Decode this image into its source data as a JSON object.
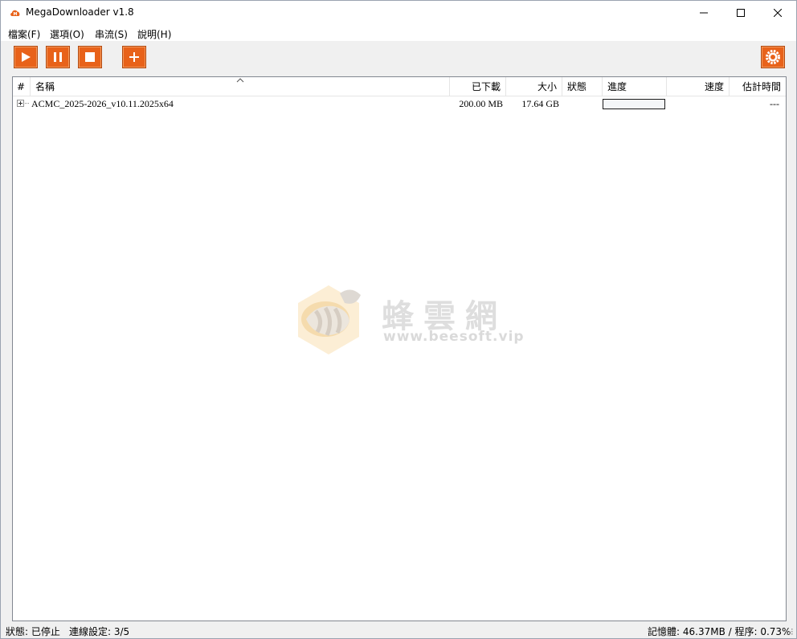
{
  "window": {
    "title": "MegaDownloader v1.8",
    "accent_color": "#e8621a"
  },
  "menu": [
    {
      "label": "檔案(F)"
    },
    {
      "label": "選項(O)"
    },
    {
      "label": "串流(S)"
    },
    {
      "label": "說明(H)"
    }
  ],
  "toolbar": {
    "buttons": [
      {
        "icon": "play-icon"
      },
      {
        "icon": "pause-icon"
      },
      {
        "icon": "stop-icon"
      },
      {
        "icon": "plus-icon"
      },
      {
        "icon": "gear-icon"
      }
    ]
  },
  "list": {
    "columns": [
      "#",
      "名稱",
      "已下載",
      "大小",
      "狀態",
      "進度",
      "速度",
      "估計時間"
    ],
    "rows": [
      {
        "name": "ACMC_2025-2026_v10.11.2025x64",
        "downloaded": "200.00 MB",
        "size": "17.64 GB",
        "status": "",
        "progress": 0,
        "speed": "",
        "eta": "---"
      }
    ]
  },
  "watermark": {
    "chinese": "蜂雲網",
    "url": "www.beesoft.vip"
  },
  "statusbar": {
    "state": "狀態: 已停止",
    "connections": "連線設定: 3/5",
    "memory": "記憶體: 46.37MB / 程序: 0.73%"
  }
}
